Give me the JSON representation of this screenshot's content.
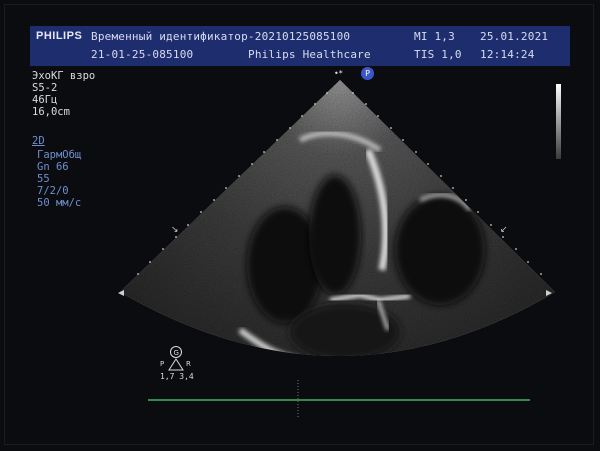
{
  "header": {
    "brand": "PHILIPS",
    "patient_id": "Временный идентификатор-20210125085100",
    "exam_id": "21-01-25-085100",
    "institution": "Philips Healthcare",
    "mi": "MI 1,3",
    "tis": "TIS 1,0",
    "date": "25.01.2021",
    "time": "12:14:24"
  },
  "params": {
    "preset": "ЭхоКГ взро",
    "probe": "S5-2",
    "frame_rate": "46Гц",
    "depth": "16,0cm",
    "mode": "2D",
    "harmonic": "ГармОбщ",
    "gain": "Gn 66",
    "compress": "55",
    "persist": "7/2/0",
    "sweep": "50 мм/с"
  },
  "probe_marker": "P",
  "orientation": {
    "badge": "G",
    "left": "P",
    "right": "R",
    "values": "1,7 3,4"
  },
  "colors": {
    "header_bg": "#1e2d6e",
    "param_blue": "#6f8fcf",
    "probe_badge": "#3a56c8",
    "ecg_trace": "#2f8a4e"
  }
}
